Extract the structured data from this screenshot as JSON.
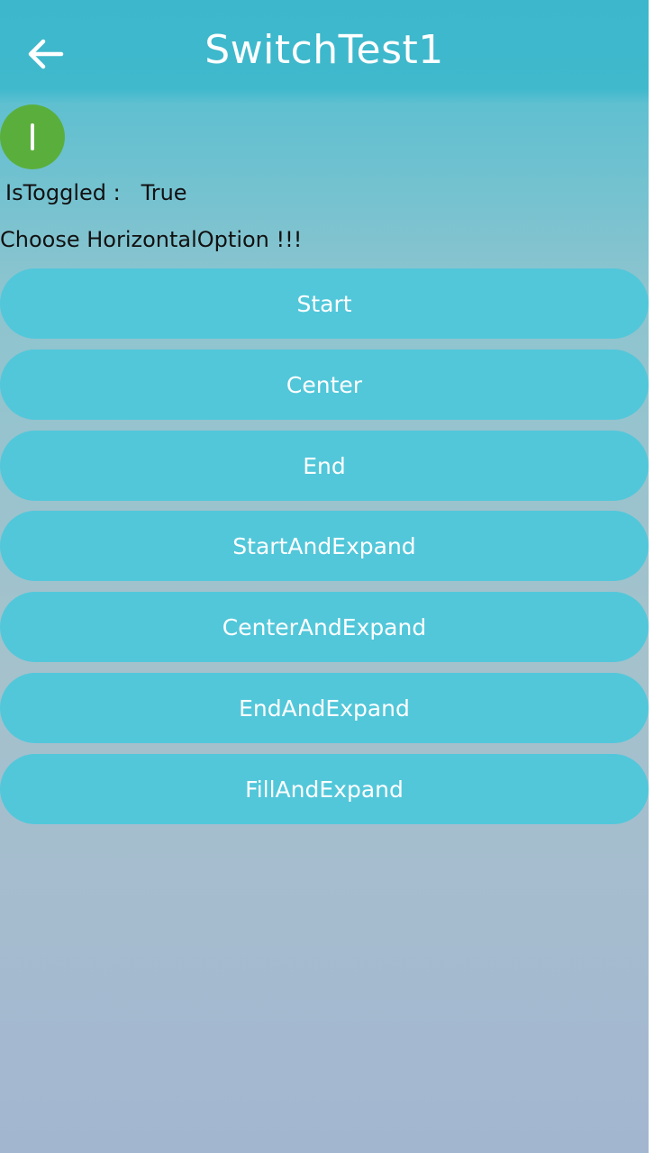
{
  "header": {
    "title": "SwitchTest1",
    "back_icon": "arrow-left-icon"
  },
  "switch": {
    "state": "on",
    "color": "#5aaf3c",
    "icon": "toggle-on-icon"
  },
  "status": {
    "label": "IsToggled :",
    "value": "True"
  },
  "prompt": "Choose HorizontalOption !!!",
  "options": [
    "Start",
    "Center",
    "End",
    "StartAndExpand",
    "CenterAndExpand",
    "EndAndExpand",
    "FillAndExpand"
  ],
  "colors": {
    "accent": "#3cb7cb",
    "button": "#52c7da"
  }
}
